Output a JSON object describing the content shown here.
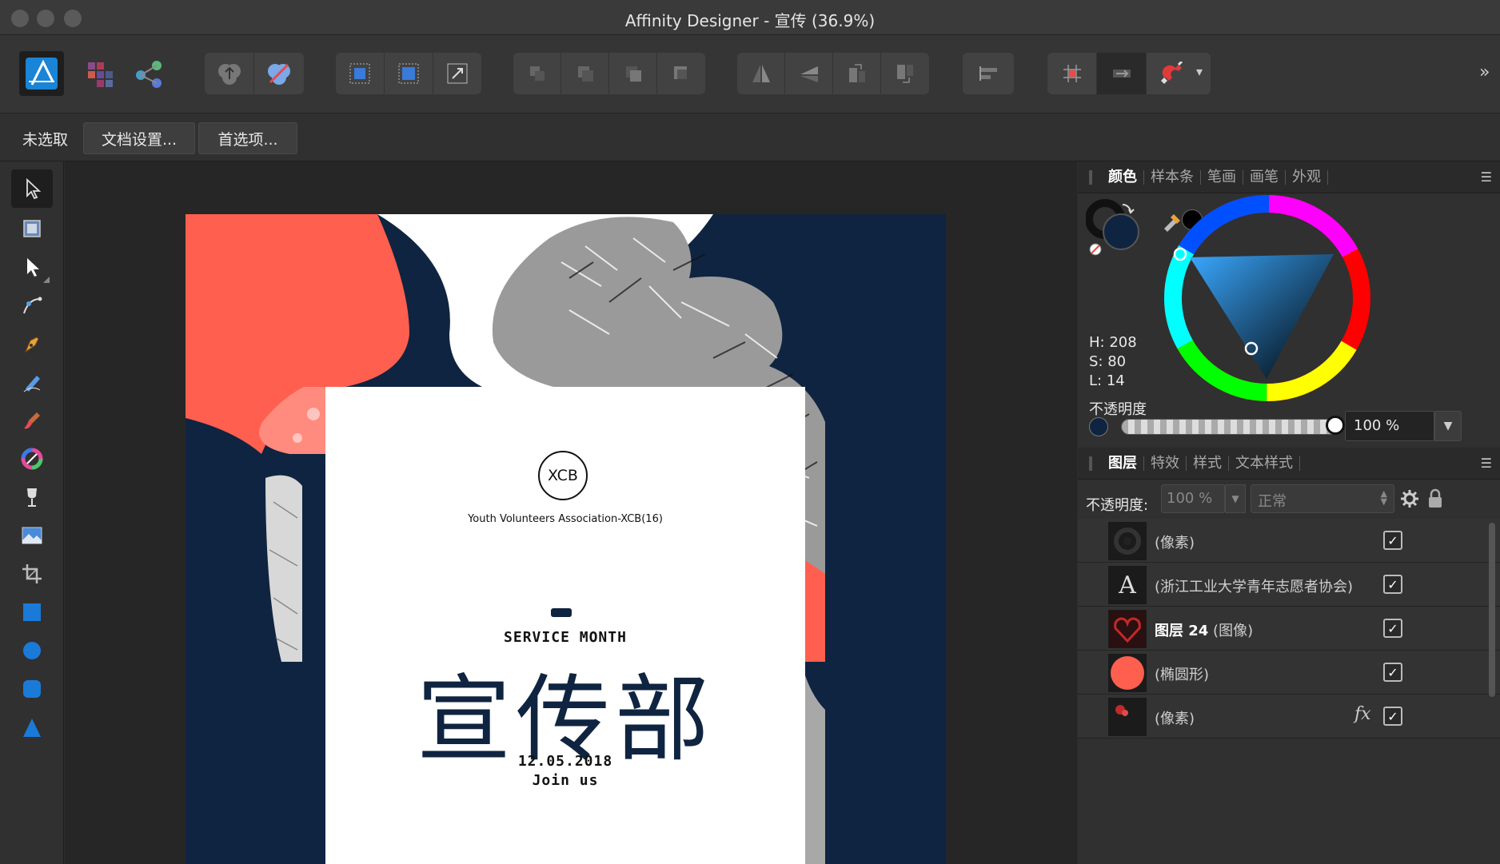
{
  "window": {
    "title": "Affinity Designer - 宣传 (36.9%)"
  },
  "toolbar": {
    "personas": [
      "designer-persona-icon",
      "pixel-persona-icon",
      "export-persona-icon"
    ],
    "groups": [
      [
        "boolean-add-icon",
        "boolean-subtract-icon"
      ],
      [
        "snap-grid-icon",
        "snap-bounds-icon",
        "transform-origin-icon"
      ],
      [
        "arrange-back-icon",
        "arrange-backward-icon",
        "arrange-forward-icon",
        "arrange-front-icon"
      ],
      [
        "flip-horizontal-icon",
        "flip-vertical-icon",
        "rotate-left-icon",
        "rotate-right-icon"
      ],
      [
        "align-icon"
      ],
      [
        "grid-icon",
        "constraint-icon",
        "snapping-magnet-icon"
      ]
    ],
    "overflow": "»",
    "dropdown": "▾"
  },
  "contextbar": {
    "selection": "未选取",
    "doc_setup": "文档设置...",
    "preferences": "首选项..."
  },
  "canvas": {
    "logo": "XCB",
    "association": "Youth Volunteers Association-XCB(16)",
    "service": "SERVICE MONTH",
    "headline": "宣传部",
    "date": "12.05.2018",
    "join": "Join us",
    "colors": {
      "coral": "#ff5f4f",
      "navy": "#0f2440",
      "white": "#ffffff"
    }
  },
  "color_panel": {
    "tabs": [
      "颜色",
      "样本条",
      "笔画",
      "画笔",
      "外观"
    ],
    "active_tab": "颜色",
    "h": "H: 208",
    "s": "S: 80",
    "l": "L: 14",
    "opacity_label": "不透明度",
    "opacity_value": "100 %",
    "opacity_fraction": 1.0,
    "fill_color": "#0f2440",
    "picked_color": "#000000"
  },
  "layers_panel": {
    "tabs": [
      "图层",
      "特效",
      "样式",
      "文本样式"
    ],
    "active_tab": "图层",
    "opacity_label": "不透明度:",
    "opacity_value": "100 %",
    "blend_mode": "正常",
    "layers": [
      {
        "name": "(像素)",
        "bold": "",
        "visible": "✓"
      },
      {
        "name": "(浙江工业大学青年志愿者协会)",
        "bold": "",
        "visible": "✓",
        "thumb_text": "A"
      },
      {
        "name": " (图像)",
        "bold": "图层 24",
        "visible": "✓"
      },
      {
        "name": "(椭圆形)",
        "bold": "",
        "visible": "✓"
      },
      {
        "name": "(像素)",
        "bold": "",
        "visible": "✓",
        "fx": "fx"
      }
    ]
  }
}
